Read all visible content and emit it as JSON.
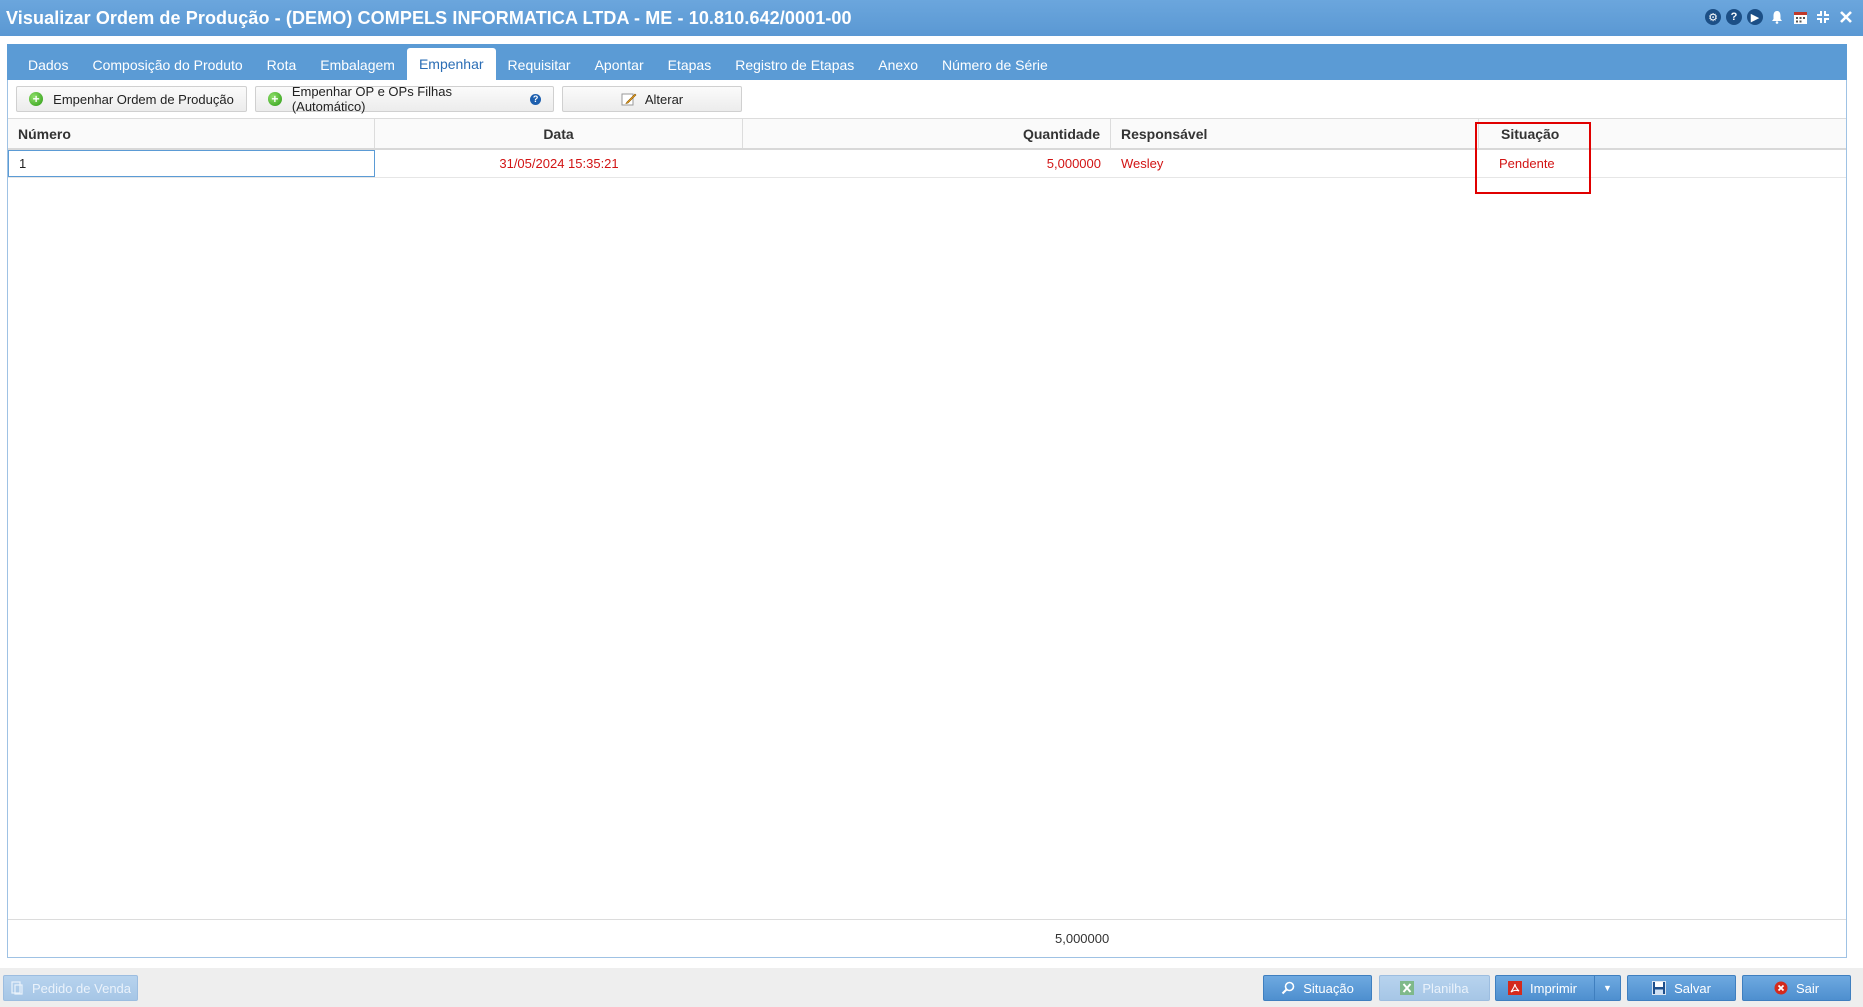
{
  "window": {
    "title": "Visualizar Ordem de Produção - (DEMO) COMPELS INFORMATICA LTDA - ME - 10.810.642/0001-00"
  },
  "tabs": [
    {
      "label": "Dados"
    },
    {
      "label": "Composição do Produto"
    },
    {
      "label": "Rota"
    },
    {
      "label": "Embalagem"
    },
    {
      "label": "Empenhar",
      "active": true
    },
    {
      "label": "Requisitar"
    },
    {
      "label": "Apontar"
    },
    {
      "label": "Etapas"
    },
    {
      "label": "Registro de Etapas"
    },
    {
      "label": "Anexo"
    },
    {
      "label": "Número de Série"
    }
  ],
  "toolbar": {
    "empenhar_op": "Empenhar Ordem de Produção",
    "empenhar_filhas": "Empenhar OP e OPs Filhas (Automático)",
    "alterar": "Alterar"
  },
  "grid": {
    "headers": {
      "numero": "Número",
      "data": "Data",
      "quantidade": "Quantidade",
      "responsavel": "Responsável",
      "situacao": "Situação"
    },
    "rows": [
      {
        "numero": "1",
        "data": "31/05/2024 15:35:21",
        "quantidade": "5,000000",
        "responsavel": "Wesley",
        "situacao": "Pendente"
      }
    ],
    "total_quantidade": "5,000000"
  },
  "bottom": {
    "pedido_venda": "Pedido de Venda",
    "situacao": "Situação",
    "planilha": "Planilha",
    "imprimir": "Imprimir",
    "salvar": "Salvar",
    "sair": "Sair"
  },
  "colors": {
    "header_blue": "#5b9bd5",
    "pending_red": "#d21414",
    "highlight_red": "#e00000"
  }
}
